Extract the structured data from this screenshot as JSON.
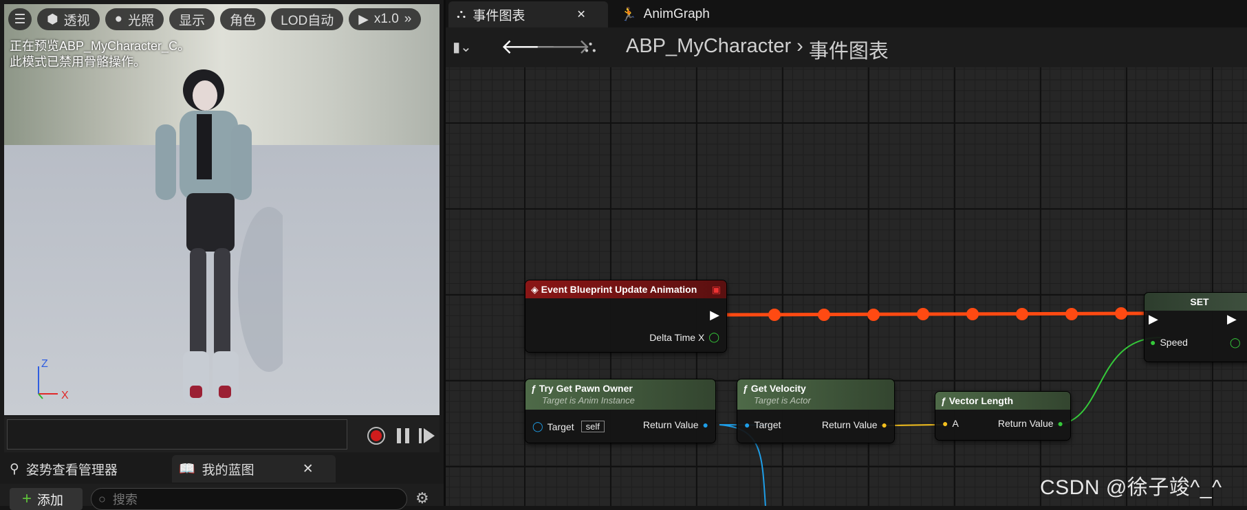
{
  "viewport": {
    "toolbar": {
      "perspective_label": "透视",
      "lighting_label": "光照",
      "show_label": "显示",
      "character_label": "角色",
      "lod_label": "LOD自动",
      "speed_label": "x1.0"
    },
    "info_line1": "正在预览ABP_MyCharacter_C。",
    "info_line2": "此模式已禁用骨骼操作。",
    "axis_z": "Z",
    "axis_x": "X"
  },
  "bottom_tabs": {
    "pose_watcher": "姿势查看管理器",
    "my_blueprint": "我的蓝图"
  },
  "add_bar": {
    "add_label": "添加",
    "search_placeholder": "搜索"
  },
  "graph_tabs": {
    "event_graph": "事件图表",
    "anim_graph": "AnimGraph"
  },
  "breadcrumb": {
    "root": "ABP_MyCharacter",
    "current": "事件图表"
  },
  "nodes": {
    "event_update": {
      "title": "Event Blueprint Update Animation",
      "pin_delta": "Delta Time X"
    },
    "try_get_pawn": {
      "title": "Try Get Pawn Owner",
      "subtitle": "Target is Anim Instance",
      "pin_target": "Target",
      "pin_default": "self",
      "pin_return": "Return Value"
    },
    "get_velocity": {
      "title": "Get Velocity",
      "subtitle": "Target is Actor",
      "pin_target": "Target",
      "pin_return": "Return Value"
    },
    "vector_length": {
      "title": "Vector Length",
      "pin_a": "A",
      "pin_return": "Return Value"
    },
    "set_node": {
      "title": "SET",
      "pin_speed": "Speed"
    }
  },
  "watermark": "CSDN @徐子竣^_^",
  "colors": {
    "event_header": "#8a1616",
    "function_header": "#4e6a48",
    "exec_wire": "#ff4a12",
    "object_pin": "#1e9ee8",
    "vector_pin": "#f4c01e",
    "float_pin": "#35c93a"
  }
}
